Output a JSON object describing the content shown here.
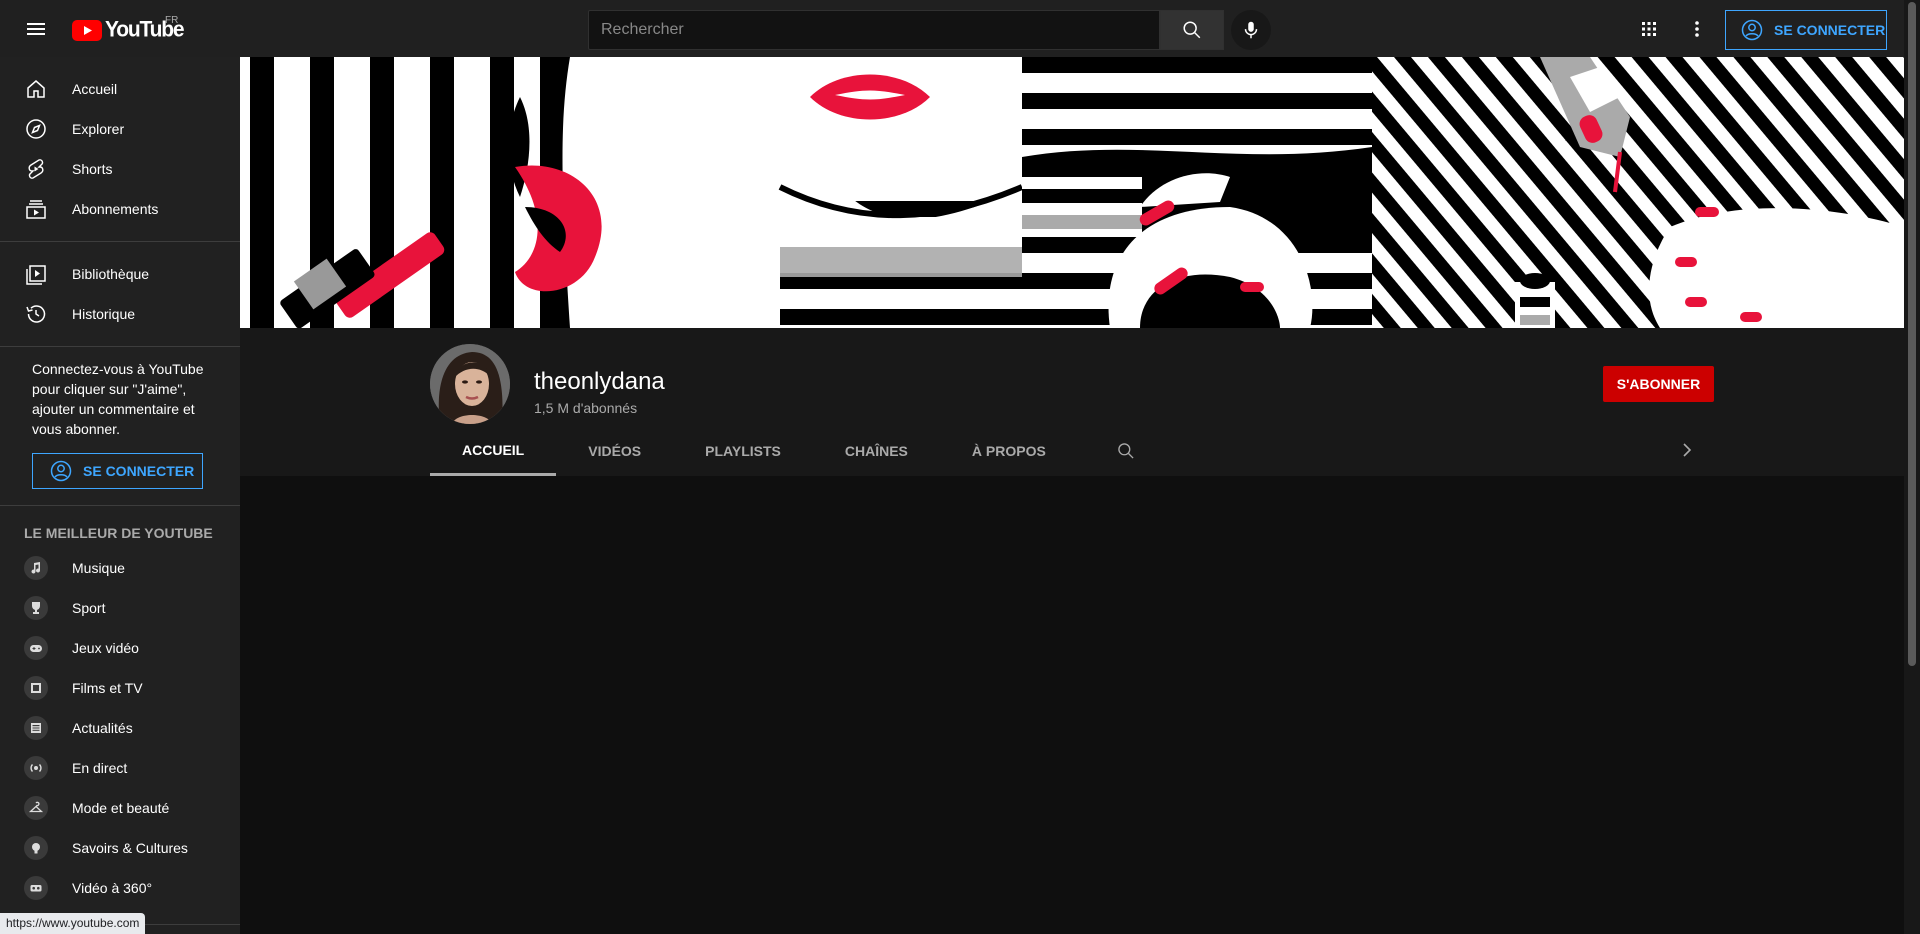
{
  "header": {
    "logo_text": "YouTube",
    "region": "FR",
    "search_placeholder": "Rechercher",
    "signin_label": "SE CONNECTER"
  },
  "sidebar": {
    "main": [
      {
        "label": "Accueil",
        "icon": "home-icon"
      },
      {
        "label": "Explorer",
        "icon": "compass-icon"
      },
      {
        "label": "Shorts",
        "icon": "shorts-icon"
      },
      {
        "label": "Abonnements",
        "icon": "subscriptions-icon"
      }
    ],
    "library": [
      {
        "label": "Bibliothèque",
        "icon": "library-icon"
      },
      {
        "label": "Historique",
        "icon": "history-icon"
      }
    ],
    "signin_blurb": "Connectez-vous à YouTube pour cliquer sur \"J'aime\", ajouter un commentaire et vous abonner.",
    "signin_label": "SE CONNECTER",
    "best_heading": "LE MEILLEUR DE YOUTUBE",
    "best": [
      {
        "label": "Musique",
        "icon": "music-icon"
      },
      {
        "label": "Sport",
        "icon": "trophy-icon"
      },
      {
        "label": "Jeux vidéo",
        "icon": "gamepad-icon"
      },
      {
        "label": "Films et TV",
        "icon": "film-icon"
      },
      {
        "label": "Actualités",
        "icon": "news-icon"
      },
      {
        "label": "En direct",
        "icon": "live-icon"
      },
      {
        "label": "Mode et beauté",
        "icon": "hanger-icon"
      },
      {
        "label": "Savoirs & Cultures",
        "icon": "lightbulb-icon"
      },
      {
        "label": "Vidéo à 360°",
        "icon": "vr-icon"
      }
    ]
  },
  "channel": {
    "name": "theonlydana",
    "subscribers": "1,5  M d'abonnés",
    "subscribe_label": "S'ABONNER",
    "tabs": [
      "ACCUEIL",
      "VIDÉOS",
      "PLAYLISTS",
      "CHAÎNES",
      "À PROPOS"
    ],
    "active_tab": "ACCUEIL"
  },
  "status_bar": {
    "url": "https://www.youtube.com"
  },
  "colors": {
    "accent_blue": "#3ea6ff",
    "subscribe_red": "#cc0000",
    "banner_red": "#e8133b"
  }
}
